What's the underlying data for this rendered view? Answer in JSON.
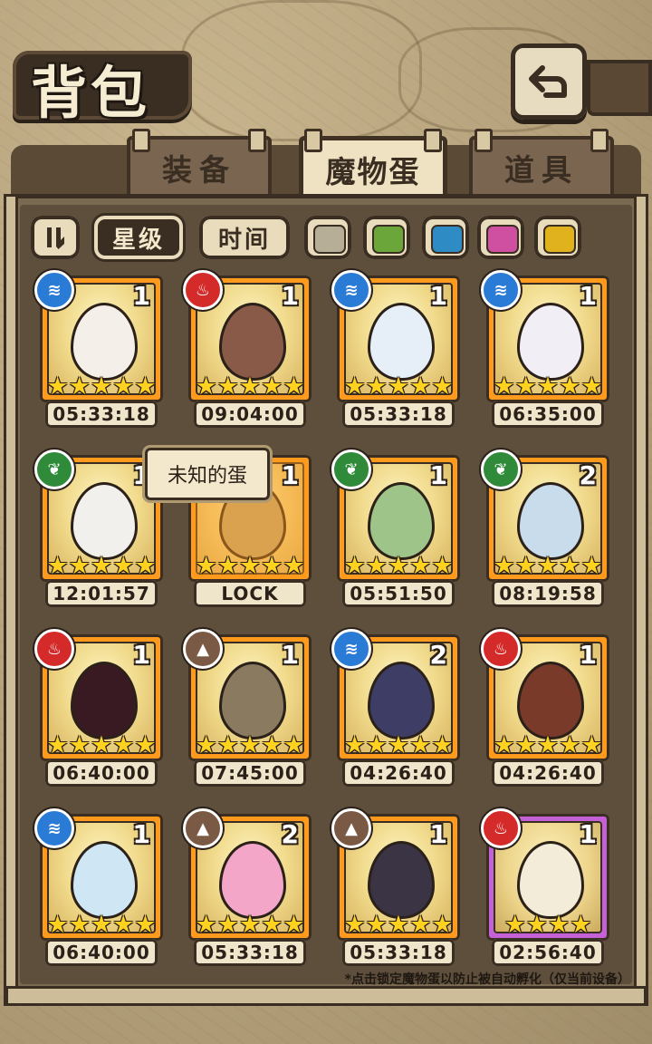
{
  "header": {
    "title": "背包",
    "back_icon": "back-arrow-icon"
  },
  "tabs": [
    {
      "label": "装备",
      "active": false
    },
    {
      "label": "魔物蛋",
      "active": true
    },
    {
      "label": "道具",
      "active": false
    }
  ],
  "filters": {
    "toggle_icon": "sort-toggle-icon",
    "sort_star_label": "星级",
    "sort_time_label": "时间",
    "colors": [
      "#b7ae98",
      "#6aa63a",
      "#2f8bc4",
      "#cf4fa0",
      "#e0b21e"
    ]
  },
  "tooltip": {
    "text": "未知的蛋"
  },
  "eggs": [
    {
      "element": "water",
      "count": "1",
      "stars": 5,
      "time": "05:33:18",
      "color": "#f4efe8"
    },
    {
      "element": "fire",
      "count": "1",
      "stars": 5,
      "time": "09:04:00",
      "color": "#8a5a48"
    },
    {
      "element": "water",
      "count": "1",
      "stars": 5,
      "time": "05:33:18",
      "color": "#e6eef8"
    },
    {
      "element": "water",
      "count": "1",
      "stars": 5,
      "time": "06:35:00",
      "color": "#f2eef6"
    },
    {
      "element": "nature",
      "count": "1",
      "stars": 5,
      "time": "12:01:57",
      "color": "#f2f0ec"
    },
    {
      "element": "",
      "count": "1",
      "stars": 5,
      "time": "LOCK",
      "color": "#bca77a",
      "locked": true
    },
    {
      "element": "nature",
      "count": "1",
      "stars": 5,
      "time": "05:51:50",
      "color": "#9fc48a"
    },
    {
      "element": "nature",
      "count": "2",
      "stars": 5,
      "time": "08:19:58",
      "color": "#c8dcec"
    },
    {
      "element": "fire",
      "count": "1",
      "stars": 5,
      "time": "06:40:00",
      "color": "#3a1a22"
    },
    {
      "element": "earth",
      "count": "1",
      "stars": 5,
      "time": "07:45:00",
      "color": "#8a7a60"
    },
    {
      "element": "water",
      "count": "2",
      "stars": 5,
      "time": "04:26:40",
      "color": "#3e3d66"
    },
    {
      "element": "fire",
      "count": "1",
      "stars": 5,
      "time": "04:26:40",
      "color": "#7a3a2a"
    },
    {
      "element": "water",
      "count": "1",
      "stars": 5,
      "time": "06:40:00",
      "color": "#cfe7f4"
    },
    {
      "element": "earth",
      "count": "2",
      "stars": 5,
      "time": "05:33:18",
      "color": "#f4a6c8"
    },
    {
      "element": "earth",
      "count": "1",
      "stars": 5,
      "time": "05:33:18",
      "color": "#3a3444"
    },
    {
      "element": "fire",
      "count": "1",
      "stars": 4,
      "time": "02:56:40",
      "color": "#f2ecd8",
      "frame": "purple"
    }
  ],
  "footer": {
    "note": "*点击锁定魔物蛋以防止被自动孵化（仅当前设备）"
  }
}
